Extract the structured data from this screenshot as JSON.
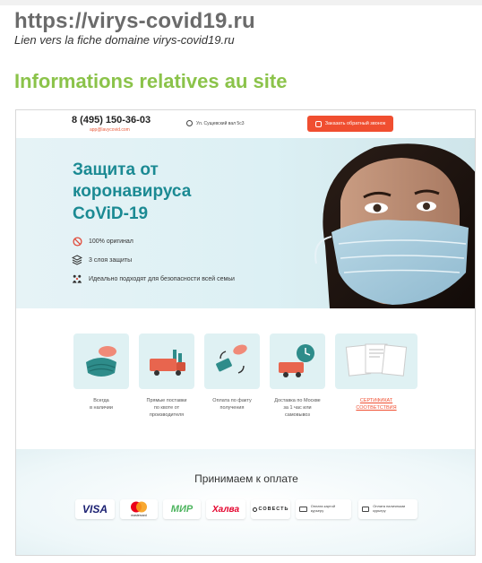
{
  "page": {
    "domain_title": "https://virys-covid19.ru",
    "domain_link": "Lien vers la fiche domaine virys-covid19.ru",
    "section_title": "Informations relatives au site"
  },
  "site": {
    "header": {
      "phone": "8 (495) 150-36-03",
      "email": "app@lavycovid.com",
      "address": "Ул. Сущевский вал 5с3",
      "callback_button": "Заказать обратный звонок"
    },
    "hero": {
      "title": "Защита от\nкоронавируса\nCoViD-19",
      "features": [
        {
          "icon": "ban-icon",
          "text": "100% оригинал"
        },
        {
          "icon": "layers-icon",
          "text": "3 слоя защиты"
        },
        {
          "icon": "family-icon",
          "text": "Идеально подходят для безопасности всей семьи"
        }
      ]
    },
    "benefits": [
      {
        "icon": "masks-stack-icon",
        "label": "Всегда\nв наличии",
        "link": false
      },
      {
        "icon": "factory-truck-icon",
        "label": "Прямые поставки\nпо квоте от\nпроизводителя",
        "link": false
      },
      {
        "icon": "cash-exchange-icon",
        "label": "Оплата по факту\nполучения",
        "link": false
      },
      {
        "icon": "delivery-clock-icon",
        "label": "Доставка по Москве\nза 1 час или\nсамовывоз",
        "link": false
      },
      {
        "icon": "certificate-docs-icon",
        "label": "СЕРТИФИКАТ\nСООТВЕТСТВИЯ",
        "link": true
      }
    ],
    "payment": {
      "title": "Принимаем к оплате",
      "methods": [
        {
          "id": "visa",
          "label": "VISA"
        },
        {
          "id": "mastercard",
          "label": "mastercard"
        },
        {
          "id": "mir",
          "label": "МИР"
        },
        {
          "id": "halva",
          "label": "Халва"
        },
        {
          "id": "sovest",
          "label": "СОВЕСТЬ"
        },
        {
          "id": "card-courier",
          "label": "Оплата картой курьеру"
        },
        {
          "id": "cash-courier",
          "label": "Оплата наличными курьеру"
        }
      ]
    }
  },
  "colors": {
    "brand_green": "#8bc34a",
    "teal": "#1b8a93",
    "accent_red": "#f04e30"
  }
}
